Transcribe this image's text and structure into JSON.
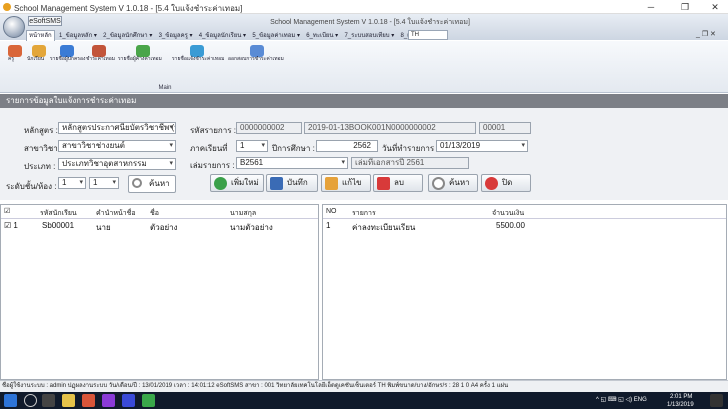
{
  "window": {
    "title": "School Management System V 1.0.18 - [5.4 ใบแจ้งชำระค่าเทอม]",
    "minimize": "─",
    "maximize": "❐",
    "close": "✕"
  },
  "ribbon": {
    "app_label": "eSoftSMS",
    "title": "School Management System V 1.0.18 - [5.4 ใบแจ้งชำระค่าเทอม]",
    "tabs": [
      "หน้าหลัก",
      "1_ข้อมูลหลัก ▾",
      "2_ข้อมูลนักศึกษา ▾",
      "3_ข้อมูลครู ▾",
      "4_ข้อมูลนักเรียน ▾",
      "5_ข้อมูลค่าเทอม ▾",
      "6_ทะเบียน ▾",
      "7_ระบบสอบเทียบ ▾",
      "8_แผนการเรียน ▾"
    ],
    "lang": "TH",
    "mdi_controls": "_ ❐ ✕",
    "buttons": [
      "ครู",
      "นักเรียน",
      "รายชื่อผู้ปกครอง",
      "ชำระค่าเทอม",
      "รายชื่อผู้ค้างค่าเทอม",
      "รายชื่อแจ้งชำระค่าเทอม",
      "ออกสอบการชำระค่าเทอม"
    ],
    "group_label": "Main"
  },
  "form_header": "รายการข้อมูลใบแจ้งการชำระค่าเทอม",
  "form": {
    "course_label": "หลักสูตร :",
    "course_value": "หลักสูตรประกาศนียบัตรวิชาชีพ (ปวช.)",
    "major_label": "สาขาวิชา :",
    "major_value": "สาขาวิชาช่างยนต์",
    "type_label": "ประเภท :",
    "type_value": "ประเภทวิชาอุตสาหกรรม",
    "level_label": "ระดับชั้น/ห้อง :",
    "level_value": "1",
    "room_value": "1",
    "search_label": "ค้นหา",
    "doc_label": "รหัสรายการ :",
    "doc_id": "0000000002",
    "doc_code": "2019-01-13BOOK001N0000000002",
    "doc_no": "00001",
    "term_label": "ภาคเรียนที่",
    "term_value": "1",
    "year_label": "ปีการศึกษา :",
    "year_value": "2562",
    "date_label": "วันที่ทำรายการ :",
    "date_value": "01/13/2019",
    "book_label": "เล่มรายการ :",
    "book_value": "B2561",
    "book_desc": "เล่มที่เอกสารปี 2561"
  },
  "actions": {
    "add": "เพิ่มใหม่",
    "save": "บันทึก",
    "edit": "แก้ไข",
    "delete": "ลบ",
    "search": "ค้นหา",
    "close": "ปิด"
  },
  "students": {
    "headers": [
      "☑",
      "รหัสนักเรียน",
      "คำนำหน้าชื่อ",
      "ชื่อ",
      "นามสกุล"
    ],
    "rows": [
      {
        "no": "☑ 1",
        "id": "Sb00001",
        "prefix": "นาย",
        "name": "ตัวอย่าง",
        "surname": "นามตัวอย่าง"
      }
    ]
  },
  "items": {
    "headers": [
      "NO",
      "รายการ",
      "จำนวนเงิน"
    ],
    "rows": [
      {
        "no": "1",
        "item": "ค่าลงทะเบียนเรียน",
        "amount": "5500.00"
      }
    ]
  },
  "status": {
    "text": "ชื่อผู้ใช้งานระบบ : admin  ปฏุผลงานระบบ  วัน/เดือน/ปี : 13/01/2019  เวลา : 14:01:12  eSoftSMS  สาขา : 001  วิทยาลัยเทคโนโลยีเอ็ดดูเคชันเซ็นเตอร์  TH  พิมพ์ขนาด/บาง/อักษร/ร : 28  1  0  A4  ครั้ง  1  แผ่น"
  },
  "taskbar": {
    "tray": "^  ◱  ⌨  ◱  ◁)  ENG",
    "time": "2:01 PM",
    "date": "1/13/2019"
  },
  "colors": {
    "form_header_bg": "#7c7f86",
    "selection_bg": "#0060c0",
    "taskbar_bg": "#101a2b"
  }
}
